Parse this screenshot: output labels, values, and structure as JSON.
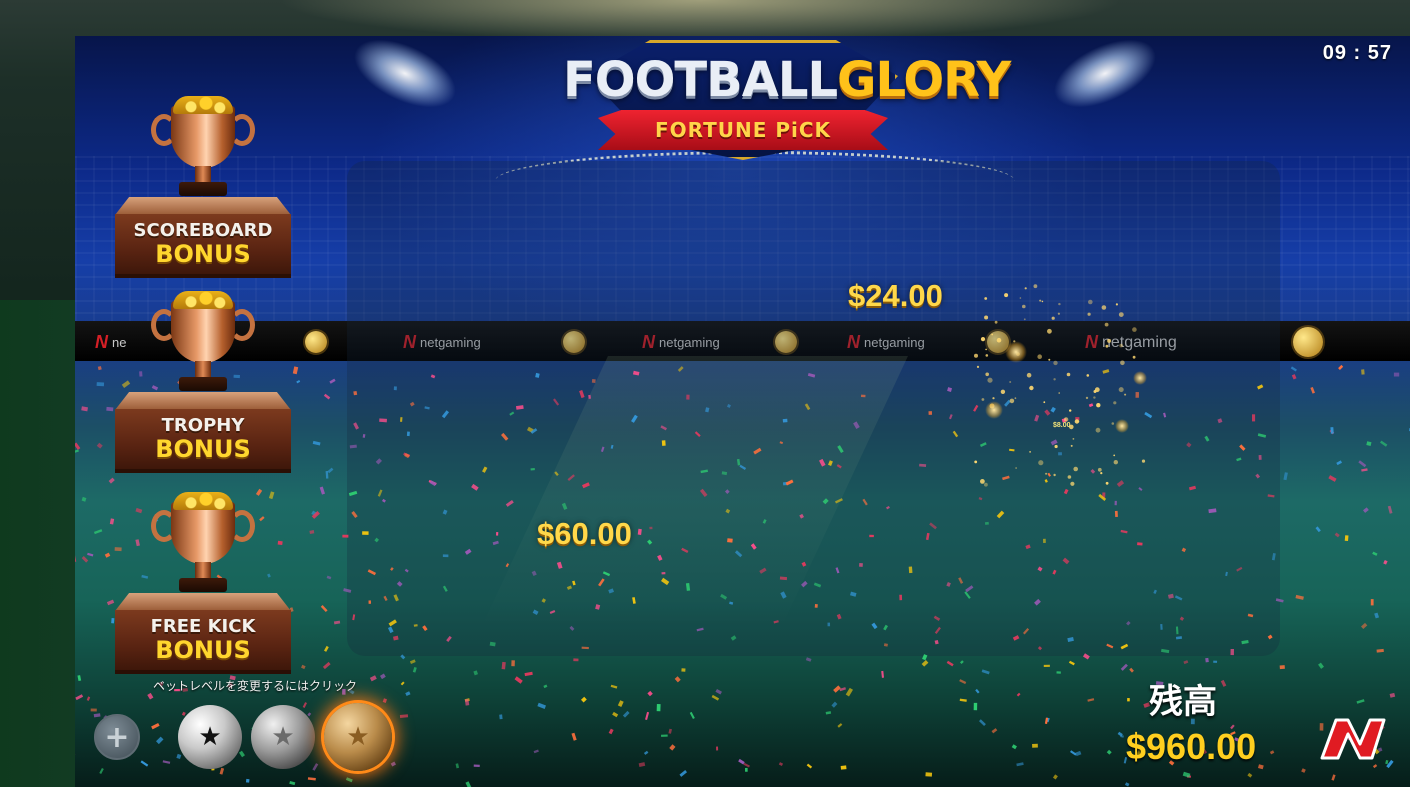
{
  "game": {
    "title_part1": "FOOTBALL",
    "title_part2": "GLORY",
    "subtitle": "FORTUNE PiCK",
    "clock": "09 : 57"
  },
  "banner": {
    "brand": "netgaming",
    "brand_first": "ne"
  },
  "prizes": [
    "$24.00",
    "$60.00",
    "$8.00"
  ],
  "bonuses": [
    {
      "title": "SCOREBOARD",
      "bonus": "BONUS"
    },
    {
      "title": "TROPHY",
      "bonus": "BONUS"
    },
    {
      "title": "FREE KICK",
      "bonus": "BONUS"
    }
  ],
  "bet": {
    "hint": "ベットレベルを変更するにはクリック",
    "plus": "+",
    "levels": [
      "black-ball",
      "silver-ball",
      "gold-ball"
    ],
    "selected": "gold-ball"
  },
  "balance": {
    "label": "残高",
    "value": "$960.00"
  },
  "colors": {
    "prize_gold": "#ffd84a",
    "brand_red": "#d41f26",
    "selected_glow": "#ff8a18"
  }
}
